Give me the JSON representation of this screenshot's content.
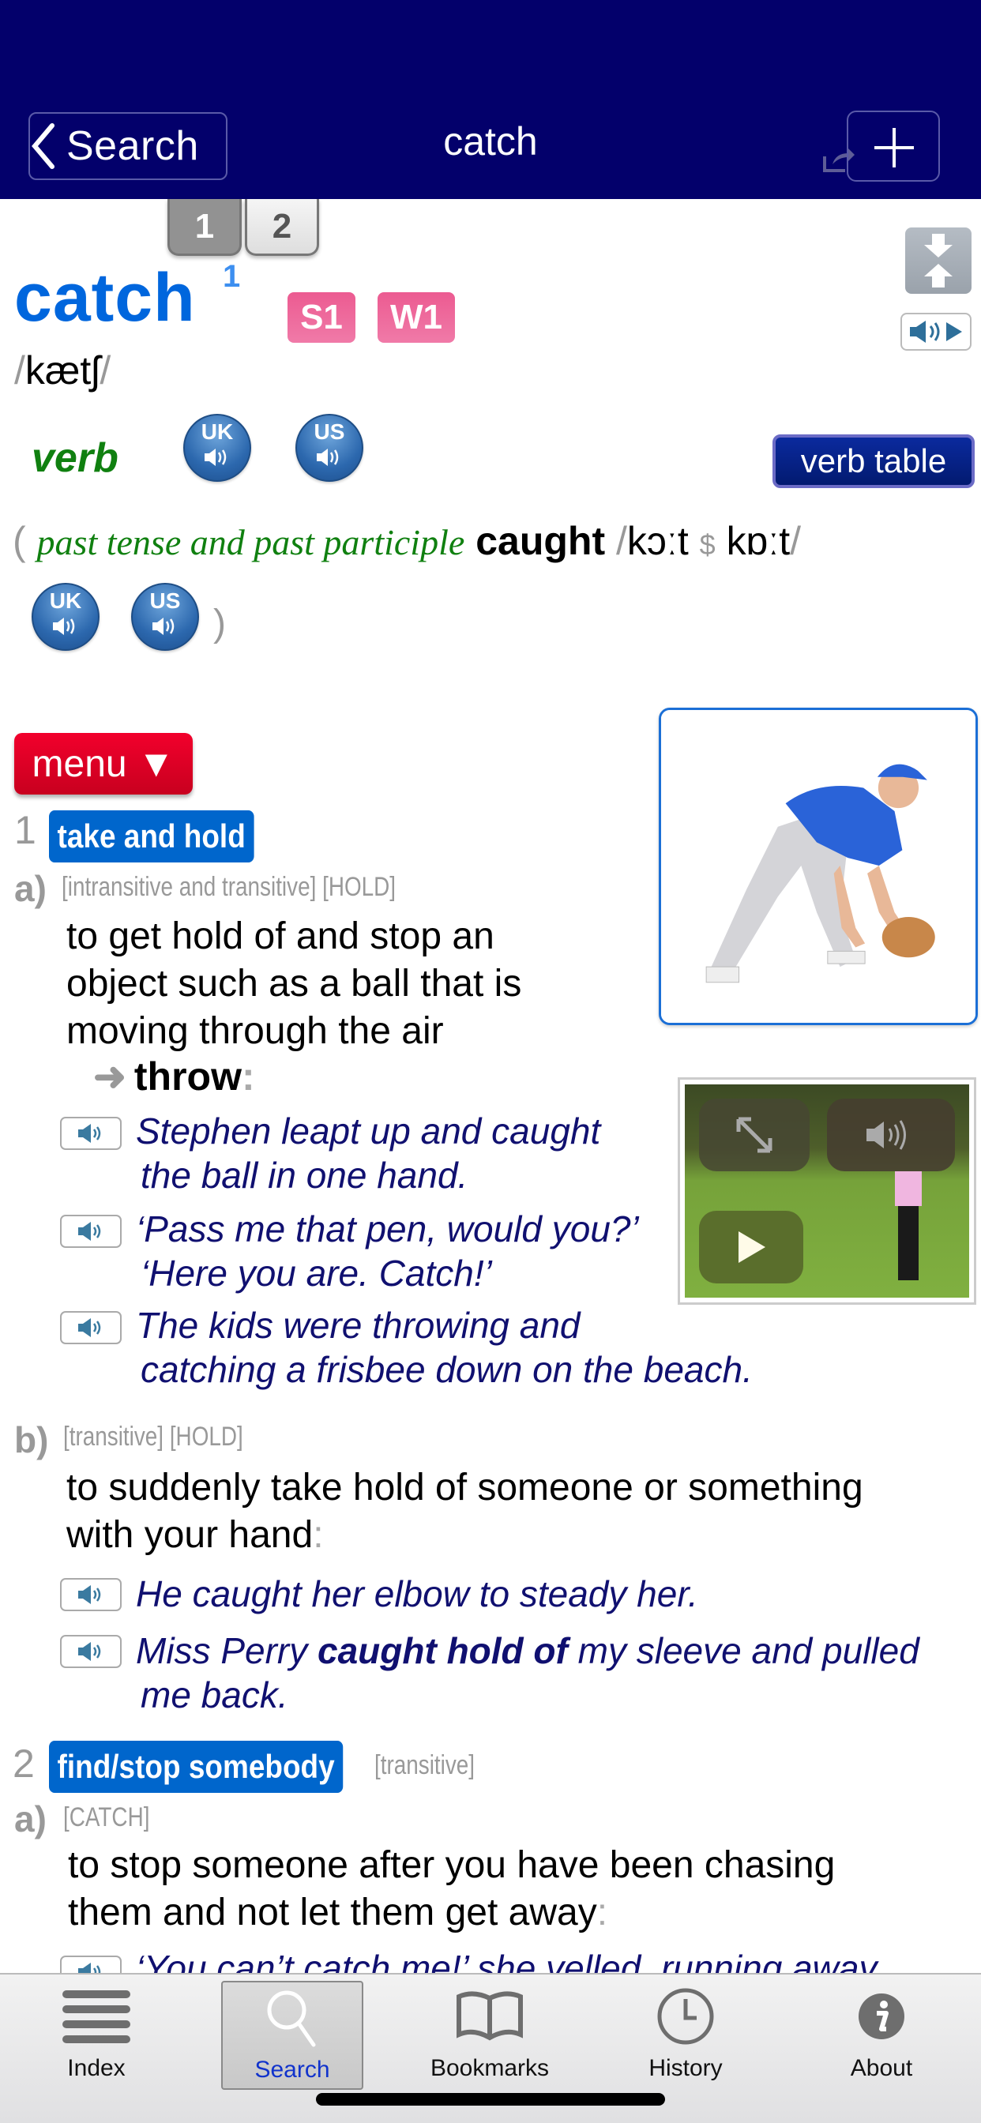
{
  "header": {
    "back_label": "Search",
    "title": "catch"
  },
  "entry": {
    "homonym_tabs": [
      "1",
      "2"
    ],
    "active_homonym": "1",
    "headword": "catch",
    "homonym_number": "1",
    "frequency_badges": [
      "S1",
      "W1"
    ],
    "pronunciation": "kætʃ",
    "part_of_speech": "verb",
    "audio_buttons": [
      {
        "label": "UK"
      },
      {
        "label": "US"
      }
    ],
    "verb_table_label": "verb table",
    "inflection": {
      "label": "past tense and past participle",
      "form": "caught",
      "pron_uk": "kɔːt",
      "dollar": "$",
      "pron_us": "kɒːt"
    }
  },
  "menu_label": "menu ▼",
  "senses": [
    {
      "number": "1",
      "signpost": "take and hold",
      "subsenses": [
        {
          "letter": "a)",
          "grammar": "[intransitive and transitive]",
          "code": "[HOLD]",
          "definition_lines": [
            "to get hold of and stop an",
            "object such as a ball that is",
            "moving through the air"
          ],
          "crossref": "throw",
          "examples": [
            {
              "lines": [
                "Stephen leapt up and caught",
                "the ball in one hand."
              ]
            },
            {
              "lines": [
                "‘Pass me that pen, would you?’",
                "‘Here you are. Catch!’"
              ]
            },
            {
              "lines": [
                "The kids were throwing and",
                "catching a frisbee down on the beach."
              ]
            }
          ]
        },
        {
          "letter": "b)",
          "grammar": "[transitive]",
          "code": "[HOLD]",
          "definition_lines": [
            "to suddenly take hold of someone or something",
            "with your hand"
          ],
          "examples": [
            {
              "lines": [
                "He caught her elbow to steady her."
              ]
            },
            {
              "pre": "Miss Perry",
              "bold": "caught hold of",
              "post": "my sleeve and pulled",
              "line2": "me back."
            }
          ]
        }
      ]
    },
    {
      "number": "2",
      "signpost": "find/stop somebody",
      "grammar": "[transitive]",
      "subsenses": [
        {
          "letter": "a)",
          "code": "[CATCH]",
          "definition_lines": [
            "to stop someone after you have been chasing",
            "them and not let them get away"
          ],
          "examples": [
            {
              "lines": [
                "‘You can’t catch me!’ she yelled, running away"
              ]
            }
          ]
        }
      ]
    }
  ],
  "media": {
    "picture_alt": "baseball player catching a ball in a glove",
    "video_controls": [
      "expand-icon",
      "volume-icon",
      "play-icon"
    ]
  },
  "tabbar": {
    "active": "Search",
    "items": [
      {
        "label": "Index",
        "icon": "list-icon"
      },
      {
        "label": "Search",
        "icon": "search-icon"
      },
      {
        "label": "Bookmarks",
        "icon": "book-icon"
      },
      {
        "label": "History",
        "icon": "clock-icon"
      },
      {
        "label": "About",
        "icon": "info-icon"
      }
    ]
  },
  "colors": {
    "header_bg": "#03006b",
    "headword": "#0066dd",
    "signpost": "#0066cc",
    "frequency_badge": "#ec5b91",
    "menu": "#e8002a",
    "example_text": "#101070",
    "pos": "#108010"
  }
}
